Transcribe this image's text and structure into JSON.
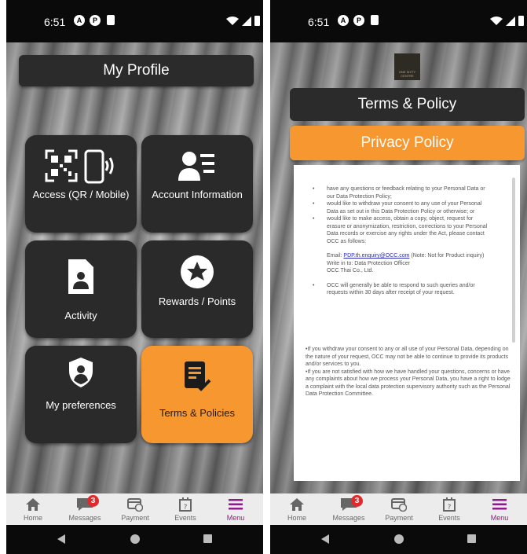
{
  "status_bar": {
    "time": "6:51"
  },
  "left_screen": {
    "title": "My Profile",
    "tiles": [
      {
        "label": "Access  (QR / Mobile)"
      },
      {
        "label": "Account Information"
      },
      {
        "label": "Activity"
      },
      {
        "label": "Rewards / Points"
      },
      {
        "label": "My preferences"
      },
      {
        "label": "Terms & Policies"
      }
    ]
  },
  "right_screen": {
    "logo_text": "ONE SIXTY CENTRE",
    "terms_title": "Terms & Policy",
    "privacy_title": "Privacy Policy",
    "bullets": [
      "have any questions or feedback relating to your Personal Data or our Data Protection Policy;",
      "would like to withdraw your consent to any use of your Personal Data as set out in this Data Protection Policy or otherwise; or",
      "would like to make access, obtain a copy, object, request for erasure or anonymization, restriction, corrections to your Personal Data records or exercise any rights under the Act, please contact OCC as follows:"
    ],
    "email_prefix": "Email: ",
    "email": "PDP.th.enquiry@OCC.com",
    "email_note": " (Note: Not for Product inquiry)",
    "write_in": "Write in to: Data Protection Officer",
    "company": "OCC Thai Co., Ltd.",
    "respond": "OCC will generally be able to respond to such queries and/or requests within 30 days after receipt of your request.",
    "tail_1": "•If you withdraw your consent to any or all use of your Personal Data, depending on the nature of your request, OCC may not be able to continue to provide its products and/or services to you.",
    "tail_2": "•If you are not satisfied with how we have handled your questions, concerns or have any complaints about how we process your Personal Data, you have a right to lodge a complaint with the local data protection supervisory authority such as the Personal Data Protection Committee."
  },
  "bottom_nav": {
    "items": [
      {
        "label": "Home",
        "icon": "home-icon"
      },
      {
        "label": "Messages",
        "icon": "chat-icon",
        "badge": "3"
      },
      {
        "label": "Payment",
        "icon": "payment-icon"
      },
      {
        "label": "Events",
        "icon": "calendar-icon"
      },
      {
        "label": "Menu",
        "icon": "menu-icon"
      }
    ],
    "active_color": "#8e1a8c"
  },
  "colors": {
    "accent": "#f7972f",
    "tile_dark": "#2a2a2a",
    "badge": "#e32929"
  }
}
